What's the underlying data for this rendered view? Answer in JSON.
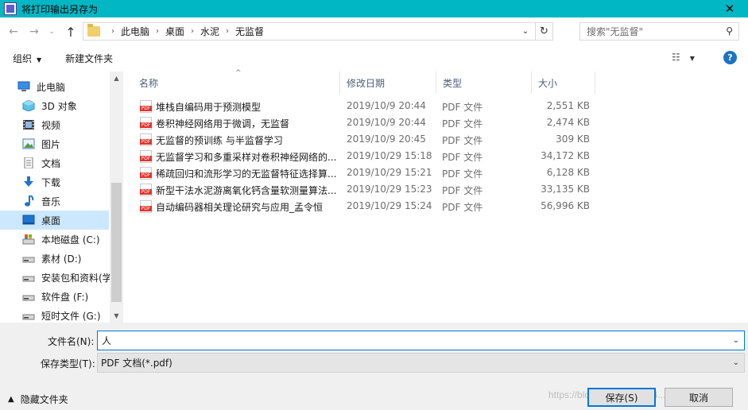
{
  "window": {
    "title": "将打印输出另存为",
    "close_glyph": "✕"
  },
  "navigation": {
    "back_glyph": "←",
    "forward_glyph": "→",
    "recent_glyph": "⌄",
    "up_glyph": "↑",
    "breadcrumb": [
      "此电脑",
      "桌面",
      "水泥",
      "无监督"
    ],
    "breadcrumb_sep": "›",
    "address_dropdown_glyph": "⌄",
    "refresh_glyph": "↻",
    "search_placeholder": "搜索\"无监督\"",
    "search_icon": "search-icon"
  },
  "toolbar": {
    "organize_label": "组织",
    "organize_caret": "▼",
    "new_folder_label": "新建文件夹",
    "view_glyph": "☷",
    "view_caret": "▼",
    "help_glyph": "?"
  },
  "sidebar": {
    "items": [
      {
        "label": "此电脑",
        "icon": "pc-icon"
      },
      {
        "label": "3D 对象",
        "icon": "3d-objects-icon"
      },
      {
        "label": "视频",
        "icon": "video-icon"
      },
      {
        "label": "图片",
        "icon": "pictures-icon"
      },
      {
        "label": "文档",
        "icon": "documents-icon"
      },
      {
        "label": "下载",
        "icon": "downloads-icon"
      },
      {
        "label": "音乐",
        "icon": "music-icon"
      },
      {
        "label": "桌面",
        "icon": "desktop-icon",
        "selected": true
      },
      {
        "label": "本地磁盘 (C:)",
        "icon": "drive-c-icon"
      },
      {
        "label": "素材 (D:)",
        "icon": "drive-icon"
      },
      {
        "label": "安装包和资料(学",
        "icon": "drive-icon"
      },
      {
        "label": "软件盘 (F:)",
        "icon": "drive-icon"
      },
      {
        "label": "短时文件 (G:)",
        "icon": "drive-icon"
      }
    ],
    "scroll_up_glyph": "▲",
    "scroll_down_glyph": "▼"
  },
  "filelist": {
    "columns": [
      "名称",
      "修改日期",
      "类型",
      "大小"
    ],
    "sort_glyph": "^",
    "rows": [
      {
        "name": "堆栈自编码用于预测模型",
        "date": "2019/10/9 20:44",
        "type": "PDF 文件",
        "size": "2,551 KB"
      },
      {
        "name": "卷积神经网络用于微调，无监督",
        "date": "2019/10/9 20:44",
        "type": "PDF 文件",
        "size": "2,474 KB"
      },
      {
        "name": "无监督的预训练 与半监督学习",
        "date": "2019/10/9 20:45",
        "type": "PDF 文件",
        "size": "309 KB"
      },
      {
        "name": "无监督学习和多重采样对卷积神经网络的...",
        "date": "2019/10/29 15:18",
        "type": "PDF 文件",
        "size": "34,172 KB"
      },
      {
        "name": "稀疏回归和流形学习的无监督特征选择算...",
        "date": "2019/10/29 15:21",
        "type": "PDF 文件",
        "size": "6,128 KB"
      },
      {
        "name": "新型干法水泥游离氧化钙含量软测量算法...",
        "date": "2019/10/29 15:23",
        "type": "PDF 文件",
        "size": "33,135 KB"
      },
      {
        "name": "自动编码器相关理论研究与应用_孟令恒",
        "date": "2019/10/29 15:24",
        "type": "PDF 文件",
        "size": "56,996 KB"
      }
    ]
  },
  "form": {
    "filename_label": "文件名(N):",
    "filename_value": "人",
    "filetype_label": "保存类型(T):",
    "filetype_value": "PDF 文档(*.pdf)",
    "dropdown_glyph": "⌄"
  },
  "footer": {
    "hide_folders_label": "隐藏文件夹",
    "hide_folders_caret": "▲",
    "save_label": "保存(S)",
    "cancel_label": "取消",
    "watermark": "https://blog.csdn.net/qq_4..."
  }
}
